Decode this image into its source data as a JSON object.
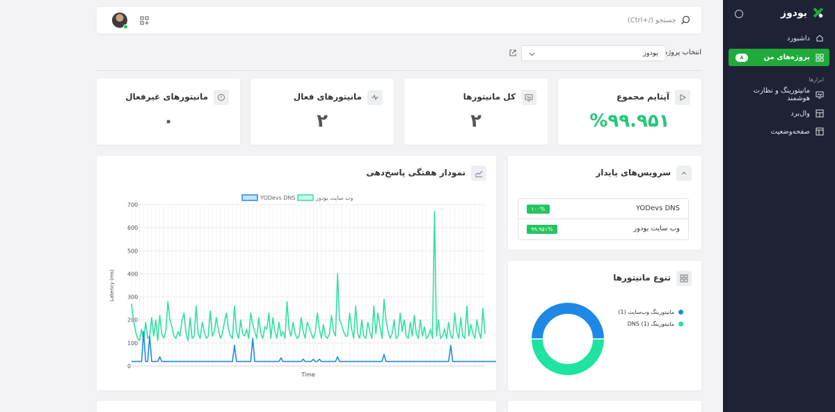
{
  "brand": {
    "name": "یودوز",
    "accent": "#1faa3a"
  },
  "sidebar": {
    "items": [
      {
        "label": "داشبورد",
        "icon": "home-icon"
      },
      {
        "label": "پروژه‌های من",
        "icon": "grid-icon",
        "badge": "۸",
        "active": true
      }
    ],
    "section_label": "ابزارها",
    "tools": [
      {
        "label": "مانیتورینگ و نظارت هوشمند",
        "icon": "monitor-icon"
      },
      {
        "label": "وال‌برد",
        "icon": "board-icon"
      },
      {
        "label": "صفحه‌وضعیت",
        "icon": "status-page-icon"
      }
    ]
  },
  "search": {
    "placeholder": "جستجو (/+Ctrl)"
  },
  "project": {
    "label": "انتخاب پروژه",
    "selected": "یودوز"
  },
  "stats": [
    {
      "title": "آپتایم مجموع",
      "value": "%۹۹.۹۵۱",
      "icon": "play-icon",
      "color": "#23c77b"
    },
    {
      "title": "کل مانیتورها",
      "value": "۲",
      "icon": "monitor-icon"
    },
    {
      "title": "مانیتورهای فعال",
      "value": "۲",
      "icon": "pulse-icon"
    },
    {
      "title": "مانیتورهای غیرفعال",
      "value": "۰",
      "icon": "alert-circle-icon"
    }
  ],
  "services": {
    "title": "سرویس‌های پایدار",
    "rows": [
      {
        "name": "YODevs DNS",
        "uptime": "۱۰۰%"
      },
      {
        "name": "وب سایت یودوز",
        "uptime": "۹۹.۹۵۱%"
      }
    ]
  },
  "variety": {
    "title": "تنوع مانیتورها",
    "legend": [
      {
        "label": "مانیتورینگ وب‌سایت (1)",
        "color": "#1e88e5"
      },
      {
        "label": "مانیتورینگ DNS (1)",
        "color": "#1ee3a1"
      }
    ]
  },
  "chart_data": {
    "type": "line",
    "title": "نمودار هفتگی پاسخ‌دهی",
    "xlabel": "Time",
    "ylabel": "Latency (ms)",
    "ylim": [
      0,
      700
    ],
    "yticks": [
      "0",
      "100",
      "200",
      "300",
      "400",
      "500",
      "600",
      "700"
    ],
    "legend_placement": "top-center",
    "grid": true,
    "series": [
      {
        "name": "وب سایت یودوز",
        "color": "#2ee0a0",
        "values": [
          270,
          200,
          150,
          120,
          110,
          160,
          110,
          190,
          120,
          130,
          210,
          130,
          200,
          110,
          220,
          140,
          120,
          150,
          280,
          200,
          170,
          130,
          120,
          150,
          130,
          200,
          230,
          140,
          110,
          210,
          120,
          130,
          260,
          140,
          120,
          190,
          150,
          120,
          130,
          240,
          130,
          150,
          210,
          160,
          120,
          140,
          190,
          230,
          160,
          130,
          120,
          260,
          150,
          120,
          200,
          140,
          130,
          160,
          120,
          230,
          180,
          150,
          120,
          210,
          140,
          120,
          170,
          160,
          230,
          120,
          210,
          150,
          120,
          190,
          130,
          150,
          120,
          280,
          160,
          130,
          190,
          140,
          120,
          130,
          210,
          150,
          120,
          190,
          170,
          140,
          120,
          150,
          230,
          160,
          120,
          180,
          130,
          120,
          140,
          220,
          150,
          130,
          400,
          200,
          180,
          150,
          130,
          130,
          230,
          160,
          120,
          260,
          140,
          120,
          200,
          130,
          120,
          190,
          150,
          120,
          260,
          140,
          230,
          170,
          120,
          290,
          200,
          150,
          120,
          140,
          200,
          120,
          130,
          230,
          150,
          200,
          130,
          120,
          190,
          130,
          220,
          140,
          120,
          200,
          130,
          170,
          120,
          130,
          160,
          120,
          670,
          130,
          200,
          120,
          130,
          160,
          120,
          190,
          130,
          120,
          230,
          150,
          120,
          210,
          130,
          120,
          260,
          130,
          180,
          140,
          120,
          200,
          150,
          120,
          250,
          140
        ]
      },
      {
        "name": "YODevs DNS",
        "color": "#1e88e5",
        "values": [
          20,
          20,
          20,
          20,
          20,
          20,
          150,
          20,
          20,
          130,
          20,
          20,
          20,
          20,
          40,
          20,
          20,
          20,
          20,
          20,
          20,
          20,
          20,
          20,
          20,
          20,
          20,
          20,
          20,
          20,
          20,
          20,
          20,
          20,
          20,
          20,
          20,
          20,
          20,
          20,
          20,
          20,
          20,
          20,
          20,
          20,
          20,
          20,
          20,
          20,
          20,
          90,
          20,
          20,
          20,
          20,
          20,
          20,
          20,
          20,
          120,
          20,
          20,
          20,
          20,
          20,
          20,
          20,
          20,
          20,
          20,
          20,
          20,
          20,
          35,
          20,
          20,
          20,
          20,
          20,
          20,
          20,
          20,
          20,
          20,
          30,
          20,
          20,
          20,
          20,
          30,
          20,
          20,
          30,
          20,
          20,
          20,
          20,
          20,
          20,
          20,
          20,
          40,
          20,
          20,
          20,
          20,
          20,
          20,
          20,
          20,
          20,
          20,
          20,
          20,
          20,
          20,
          20,
          20,
          20,
          20,
          20,
          20,
          20,
          20,
          50,
          20,
          20,
          20,
          20,
          20,
          20,
          20,
          20,
          20,
          20,
          20,
          20,
          20,
          20,
          20,
          20,
          20,
          20,
          20,
          20,
          20,
          20,
          20,
          20,
          20,
          20,
          20,
          20,
          20,
          20,
          20,
          20,
          90,
          20,
          20,
          20,
          20,
          20,
          20,
          20,
          20,
          20,
          20,
          20,
          20,
          20,
          20,
          20,
          20,
          20,
          20,
          20,
          20,
          20,
          20,
          20,
          20,
          20,
          20,
          20,
          20,
          20,
          20,
          20,
          20,
          20
        ]
      }
    ]
  },
  "donut_data": {
    "type": "pie",
    "slices": [
      {
        "label": "مانیتورینگ وب‌سایت (1)",
        "value": 1,
        "color": "#1e88e5"
      },
      {
        "label": "مانیتورینگ DNS (1)",
        "value": 1,
        "color": "#1ee3a1"
      }
    ]
  }
}
